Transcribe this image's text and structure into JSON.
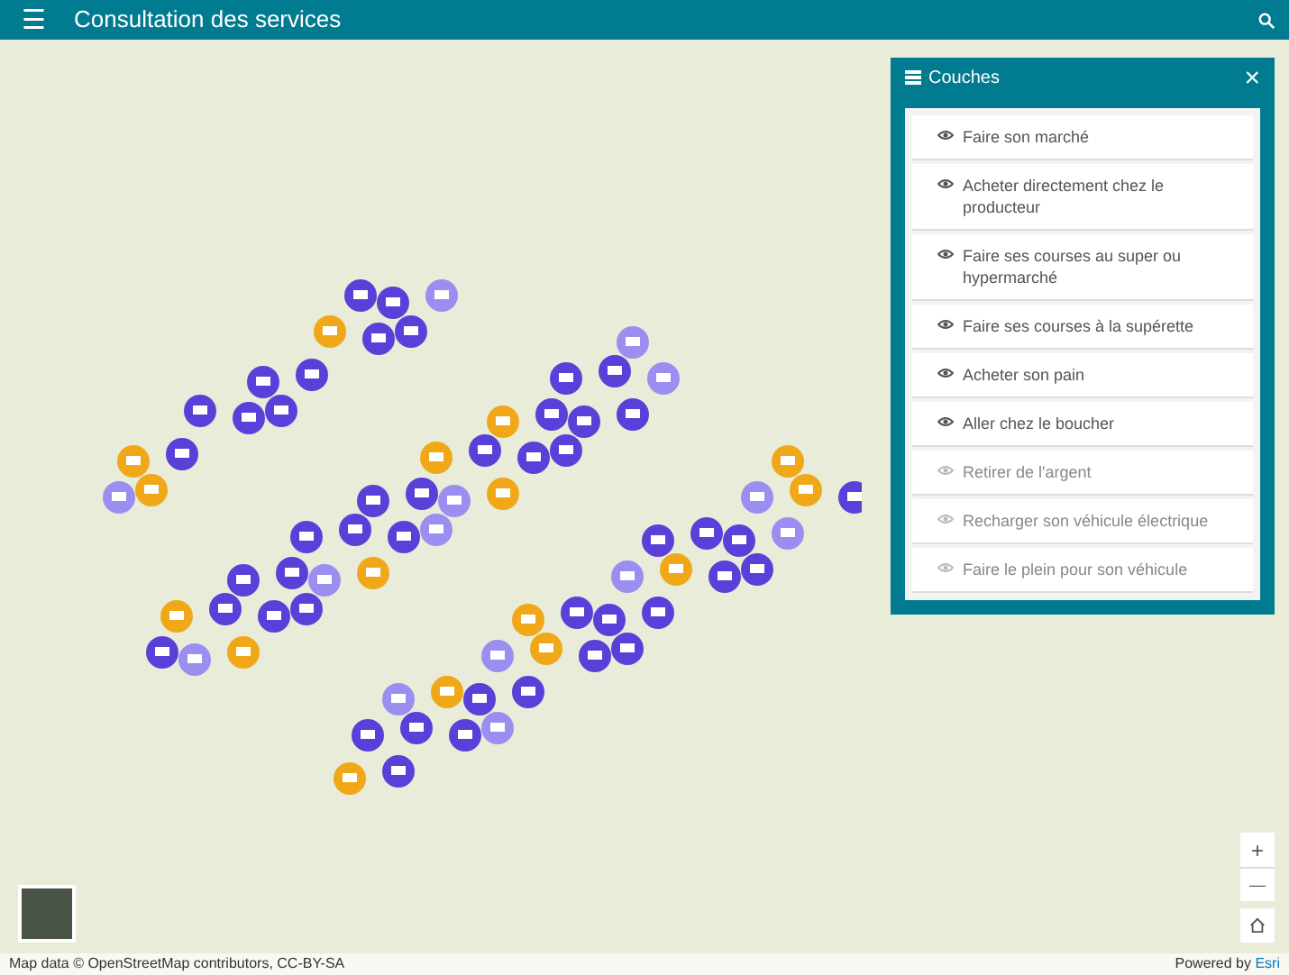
{
  "header": {
    "menu_glyph": "☰",
    "title": "Consultation des services"
  },
  "layers_panel": {
    "title": "Couches",
    "close_glyph": "×",
    "layers": [
      {
        "label": "Faire son marché",
        "visible": true
      },
      {
        "label": "Acheter directement chez le producteur",
        "visible": true
      },
      {
        "label": "Faire ses courses au super ou hypermarché",
        "visible": true
      },
      {
        "label": "Faire ses courses à la supérette",
        "visible": true
      },
      {
        "label": "Acheter son pain",
        "visible": true
      },
      {
        "label": "Aller chez le boucher",
        "visible": true
      },
      {
        "label": "Retirer de l'argent",
        "visible": false
      },
      {
        "label": "Recharger son véhicule électrique",
        "visible": false
      },
      {
        "label": "Faire le plein pour son véhicule",
        "visible": false
      }
    ]
  },
  "zoom_controls": {
    "zoom_in": "+",
    "zoom_out": "—"
  },
  "attribution": "Map data © OpenStreetMap contributors, CC-BY-SA",
  "powered_by": {
    "text": "Powered by ",
    "link": "Esri"
  }
}
